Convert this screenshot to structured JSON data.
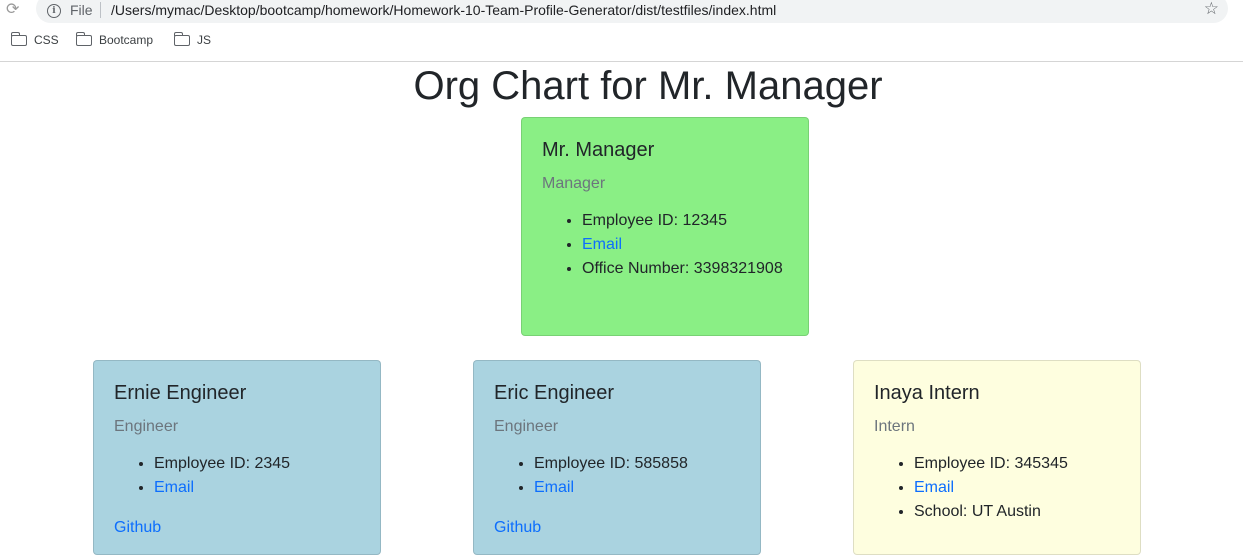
{
  "browser": {
    "scheme": "File",
    "url": "/Users/mymac/Desktop/bootcamp/homework/Homework-10-Team-Profile-Generator/dist/testfiles/index.html",
    "bookmarks": [
      "CSS",
      "Bootcamp",
      "JS"
    ]
  },
  "page": {
    "title": "Org Chart for Mr. Manager"
  },
  "manager": {
    "name": "Mr. Manager",
    "role": "Manager",
    "id_text": "Employee ID: 12345",
    "email_label": "Email",
    "office_text": "Office Number: 3398321908"
  },
  "engineers": [
    {
      "name": "Ernie Engineer",
      "role": "Engineer",
      "id_text": "Employee ID: 2345",
      "email_label": "Email",
      "github_label": "Github"
    },
    {
      "name": "Eric Engineer",
      "role": "Engineer",
      "id_text": "Employee ID: 585858",
      "email_label": "Email",
      "github_label": "Github"
    }
  ],
  "intern": {
    "name": "Inaya Intern",
    "role": "Intern",
    "id_text": "Employee ID: 345345",
    "email_label": "Email",
    "school_text": "School: UT Austin"
  },
  "colors": {
    "manager_card": "#8aef85",
    "engineer_card": "#aad3e0",
    "intern_card": "#fefedf",
    "link": "#0d6efd"
  }
}
